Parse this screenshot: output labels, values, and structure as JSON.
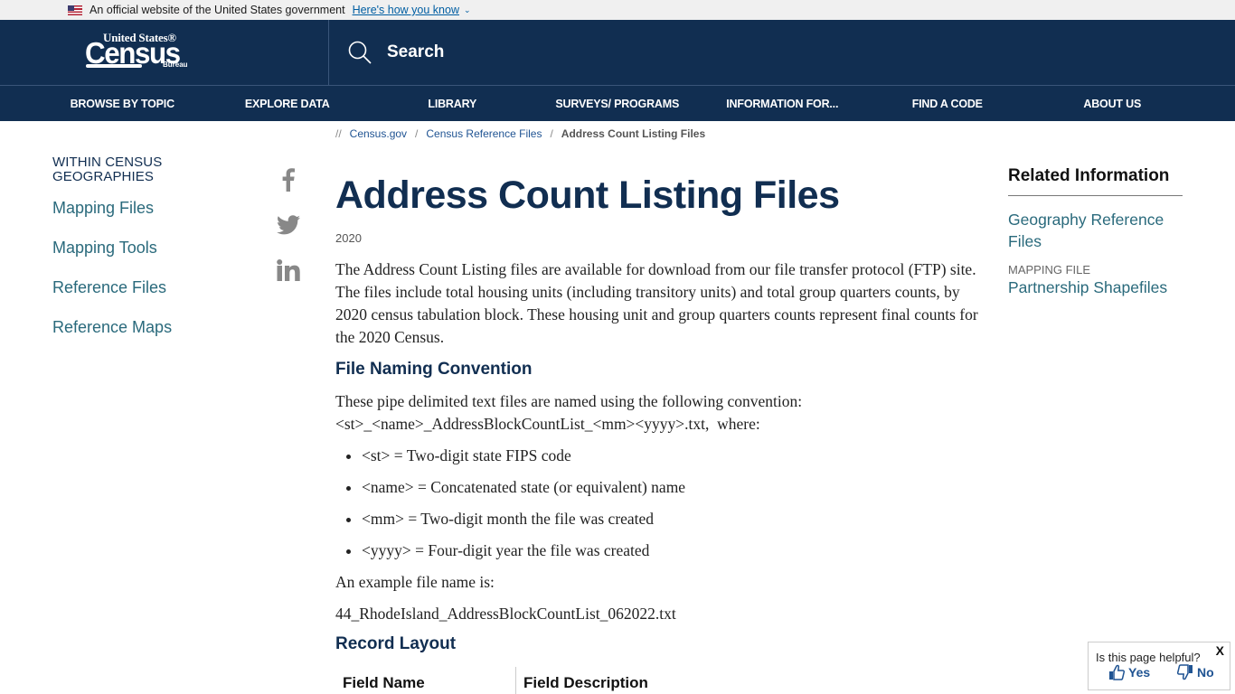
{
  "gov_banner": {
    "text": "An official website of the United States government",
    "link": "Here's how you know"
  },
  "logo": {
    "line1": "United States®",
    "line2": "Census",
    "line3": "Bureau"
  },
  "search": {
    "label": "Search"
  },
  "nav": {
    "items": [
      {
        "label": "BROWSE BY TOPIC"
      },
      {
        "label": "EXPLORE DATA"
      },
      {
        "label": "LIBRARY"
      },
      {
        "label": "SURVEYS/ PROGRAMS"
      },
      {
        "label": "INFORMATION FOR..."
      },
      {
        "label": "FIND A CODE"
      },
      {
        "label": "ABOUT US"
      }
    ]
  },
  "breadcrumb": {
    "prefix": "//",
    "items": [
      {
        "label": "Census.gov"
      },
      {
        "label": "Census Reference Files"
      },
      {
        "label": "Address Count Listing Files"
      }
    ]
  },
  "sidebar": {
    "title": "WITHIN CENSUS GEOGRAPHIES",
    "links": [
      {
        "label": "Mapping Files"
      },
      {
        "label": "Mapping Tools"
      },
      {
        "label": "Reference Files"
      },
      {
        "label": "Reference Maps"
      }
    ]
  },
  "social": {
    "icons": [
      "facebook-icon",
      "twitter-icon",
      "linkedin-icon"
    ]
  },
  "main": {
    "title": "Address Count Listing Files",
    "year": "2020",
    "intro": "The Address Count Listing files are available for download from our file transfer protocol (FTP) site. The files include total housing units (including transitory units) and total group quarters counts, by 2020 census tabulation block. These housing unit and group quarters counts represent final counts for the 2020 Census.",
    "naming_heading": "File Naming Convention",
    "naming_text_1": "These pipe delimited text files are named using the following convention:",
    "naming_text_2": "<st>_<name>_AddressBlockCountList_<mm><yyyy>.txt,  where:",
    "bullets": [
      "<st> = Two-digit state FIPS code",
      "<name> = Concatenated state (or equivalent) name",
      "<mm> = Two-digit month the file was created",
      "<yyyy> = Four-digit year the file was created"
    ],
    "example_label": "An example file name is:",
    "example_file": "44_RhodeIsland_AddressBlockCountList_062022.txt",
    "record_heading": "Record Layout",
    "table_headers": [
      "Field Name",
      "Field Description"
    ]
  },
  "related": {
    "title": "Related Information",
    "link1": "Geography Reference Files",
    "label2": "MAPPING FILE",
    "link2": "Partnership Shapefiles"
  },
  "feedback": {
    "question": "Is this page helpful?",
    "yes": "Yes",
    "no": "No",
    "close": "X"
  },
  "colors": {
    "header_bg": "#112e51",
    "link": "#2a6a7c",
    "title": "#112e51"
  }
}
